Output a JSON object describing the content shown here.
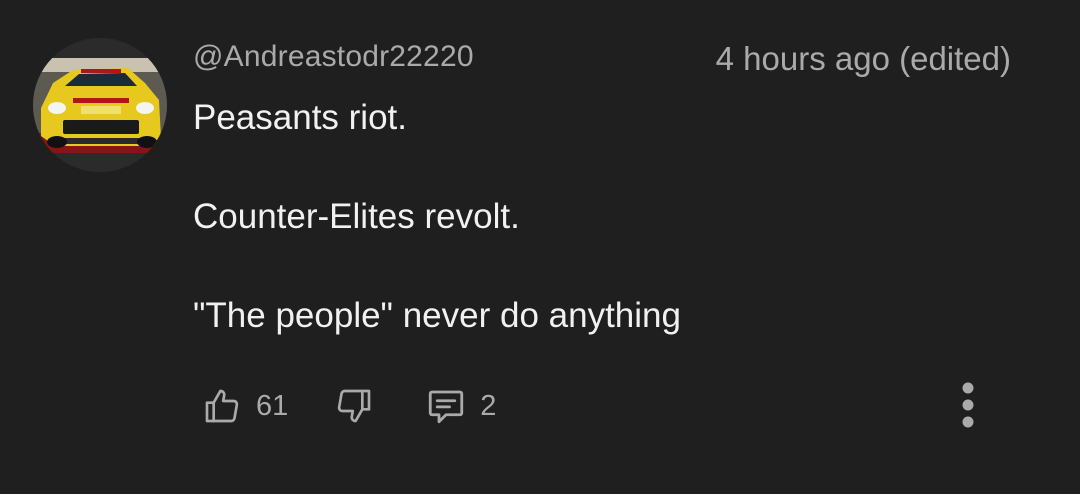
{
  "comment": {
    "author": "@Andreastodr22220",
    "timestamp": "4 hours ago (edited)",
    "body_lines": [
      "Peasants riot.",
      "Counter-Elites revolt.",
      "\"The people\" never do anything"
    ],
    "avatar_description": "yellow rally car",
    "actions": {
      "like_count": "61",
      "reply_count": "2",
      "like_icon": "thumbs-up-icon",
      "dislike_icon": "thumbs-down-icon",
      "reply_icon": "comment-icon",
      "more_icon": "more-vertical-icon"
    }
  },
  "colors": {
    "background": "#1f1f1f",
    "primary_text": "#f1f1f1",
    "secondary_text": "#aaaaaa",
    "icon": "#aaaaaa"
  }
}
